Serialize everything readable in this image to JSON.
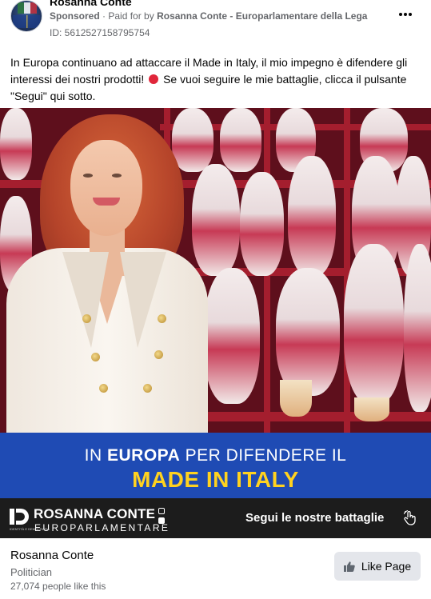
{
  "header": {
    "author": "Rosanna Conte",
    "sponsored_label": "Sponsored",
    "separator": "·",
    "paid_for_prefix": "Paid for by",
    "paid_for_by": "Rosanna Conte - Europarlamentare della Lega",
    "ad_id": "ID: 5612527158795754",
    "more_icon": "more-horizontal-icon"
  },
  "post": {
    "text_part1": "In Europa continuano ad attaccare il Made in Italy, il mio impegno è difendere gli interessi dei nostri prodotti!",
    "text_part2": "Se vuoi seguire le mie battaglie, clicca il pulsante \"Segui\" qui sotto.",
    "emoji": "red-circle-icon"
  },
  "ad_image": {
    "line1_normal1": "IN ",
    "line1_bold": "EUROPA",
    "line1_normal2": " PER DIFENDERE IL",
    "line2": "MADE IN ITALY",
    "brand_name": "ROSANNA CONTE",
    "brand_sub": "EUROPARLAMENTARE",
    "logo_tagline": "IDENTITÀ E DEMOCRAZIA",
    "cta": "Segui le nostre battaglie",
    "colors": {
      "band_blue": "#1f4bb4",
      "headline_yellow": "#ffd21f",
      "bottom_band": "#1c1c1c"
    }
  },
  "footer": {
    "page_name": "Rosanna Conte",
    "category": "Politician",
    "likes": "27,074 people like this",
    "like_button_label": "Like Page",
    "like_icon": "thumbs-up-icon"
  }
}
